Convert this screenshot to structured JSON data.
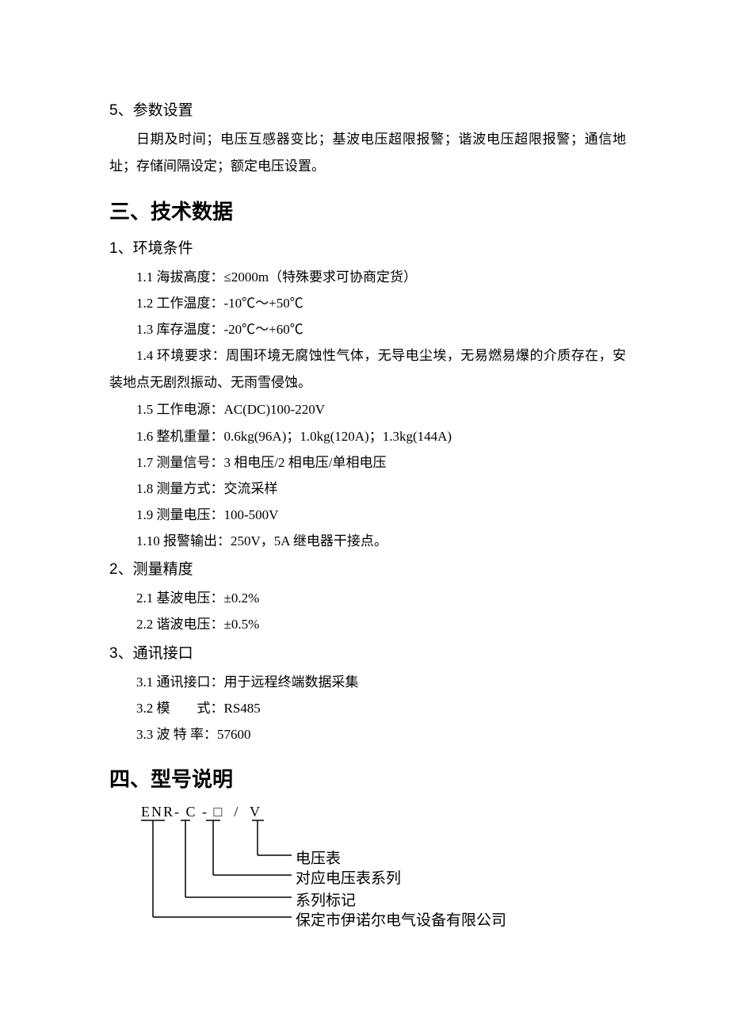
{
  "sec5": {
    "title": "5、参数设置",
    "para": "日期及时间；电压互感器变比；基波电压超限报警；谐波电压超限报警；通信地址；存储间隔设定；额定电压设置。"
  },
  "sec3main": {
    "title": "三、技术数据",
    "sub1": {
      "title": "1、环境条件",
      "items": [
        "1.1 海拔高度：≤2000m（特殊要求可协商定货）",
        "1.2 工作温度：-10℃～+50℃",
        "1.3 库存温度：-20℃～+60℃"
      ],
      "para14": "1.4 环境要求：周围环境无腐蚀性气体，无导电尘埃，无易燃易爆的介质存在，安装地点无剧烈振动、无雨雪侵蚀。",
      "items2": [
        "1.5 工作电源：AC(DC)100-220V",
        "1.6 整机重量：0.6kg(96A)；1.0kg(120A)；1.3kg(144A)",
        "1.7 测量信号：3 相电压/2 相电压/单相电压",
        "1.8 测量方式：交流采样",
        "1.9 测量电压：100-500V",
        "1.10 报警输出：250V，5A 继电器干接点。"
      ]
    },
    "sub2": {
      "title": "2、测量精度",
      "items": [
        "2.1 基波电压：±0.2%",
        "2.2 谐波电压：±0.5%"
      ]
    },
    "sub3": {
      "title": "3、通讯接口",
      "items": [
        "3.1 通讯接口：用于远程终端数据采集",
        "3.2 模　　式：RS485",
        "3.3 波 特 率：57600"
      ]
    }
  },
  "sec4main": {
    "title": "四、型号说明",
    "model": "ENR- C - □  /  V",
    "labels": [
      "电压表",
      "对应电压表系列",
      "系列标记",
      "保定市伊诺尔电气设备有限公司"
    ]
  }
}
